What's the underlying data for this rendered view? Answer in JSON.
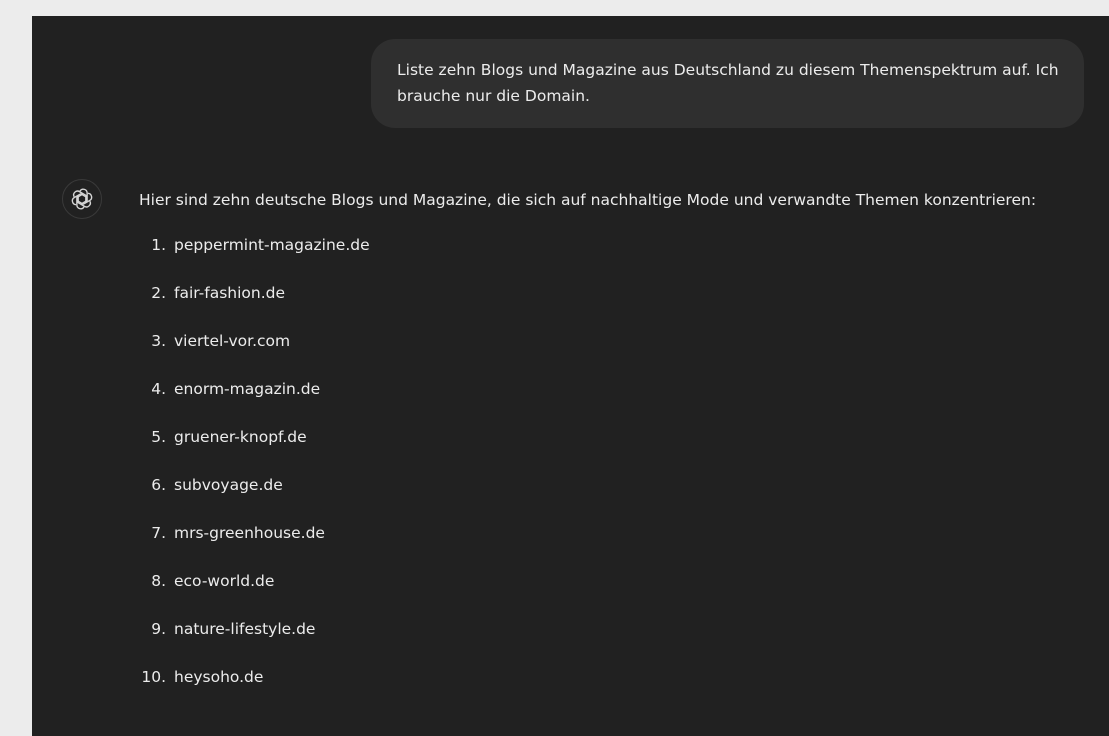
{
  "user_message": {
    "text": "Liste zehn Blogs und Magazine aus Deutschland zu diesem Themenspektrum auf. Ich brauche nur die Domain."
  },
  "assistant_message": {
    "avatar_icon": "openai-logo-icon",
    "intro": "Hier sind zehn deutsche Blogs und Magazine, die sich auf nachhaltige Mode und verwandte Themen konzentrieren:",
    "items": [
      {
        "number": "1.",
        "domain": "peppermint-magazine.de"
      },
      {
        "number": "2.",
        "domain": "fair-fashion.de"
      },
      {
        "number": "3.",
        "domain": "viertel-vor.com"
      },
      {
        "number": "4.",
        "domain": "enorm-magazin.de"
      },
      {
        "number": "5.",
        "domain": "gruener-knopf.de"
      },
      {
        "number": "6.",
        "domain": "subvoyage.de"
      },
      {
        "number": "7.",
        "domain": "mrs-greenhouse.de"
      },
      {
        "number": "8.",
        "domain": "eco-world.de"
      },
      {
        "number": "9.",
        "domain": "nature-lifestyle.de"
      },
      {
        "number": "10.",
        "domain": "heysoho.de"
      }
    ]
  },
  "colors": {
    "background": "#212121",
    "user_bubble": "#2f2f2f",
    "text": "#ececec"
  }
}
